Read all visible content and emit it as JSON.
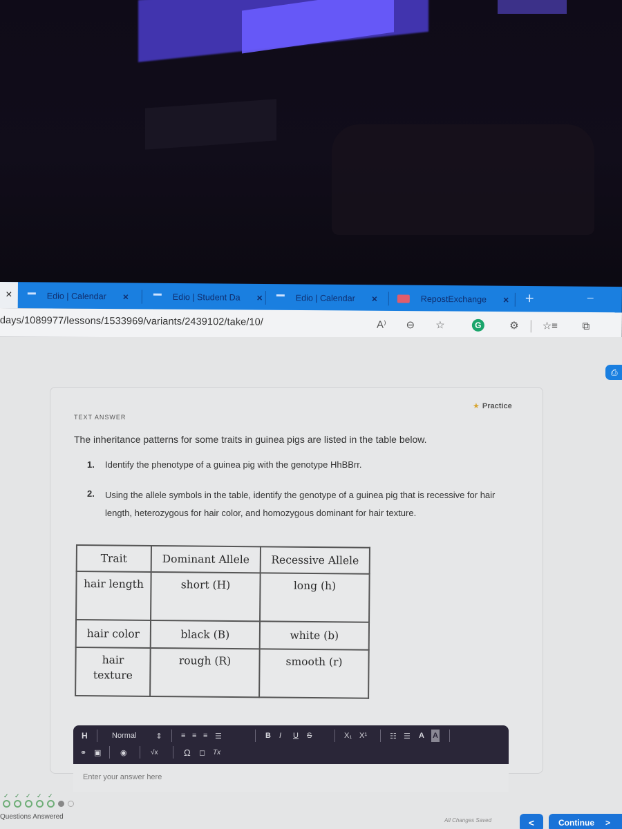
{
  "browser": {
    "tabs": [
      {
        "label": "Edio | Calendar",
        "favicon": "dash-icon"
      },
      {
        "label": "Edio | Student Da",
        "favicon": "dash-icon"
      },
      {
        "label": "Edio | Calendar",
        "favicon": "dash-icon"
      },
      {
        "label": "RepostExchange",
        "favicon": "repostexchange-icon"
      }
    ],
    "close_glyph": "×",
    "new_tab_glyph": "+",
    "minimize_glyph": "–",
    "url": "days/1089977/lessons/1533969/variants/2439102/take/10/",
    "toolbar_icons": [
      "read-aloud-icon",
      "zoom-out-icon",
      "add-favorite-icon",
      "grammarly-icon",
      "extensions-icon",
      "favorites-icon",
      "collections-icon"
    ],
    "toolbar_glyphs": {
      "read_aloud": "A⁾",
      "zoom_out": "⊖",
      "add_favorite": "☆",
      "grammarly": "G",
      "extensions": "⚙",
      "favorites": "☆≡",
      "collections": "⧉"
    }
  },
  "question": {
    "badge": "Practice",
    "badge_icon": "★",
    "type_label": "TEXT ANSWER",
    "intro": "The inheritance patterns for some traits in guinea pigs are listed in the table below.",
    "items": [
      {
        "num": "1.",
        "text": "Identify the phenotype of a guinea pig with the genotype HhBBrr."
      },
      {
        "num": "2.",
        "text": "Using the allele symbols in the table, identify the genotype of a guinea pig that is recessive for hair length, heterozygous for hair color, and homozygous dominant for hair texture."
      }
    ],
    "table": {
      "headers": [
        "Trait",
        "Dominant Allele",
        "Recessive Allele"
      ],
      "rows": [
        [
          "hair length",
          "short (H)",
          "long (h)"
        ],
        [
          "hair color",
          "black (B)",
          "white (b)"
        ],
        [
          "hair texture",
          "rough (R)",
          "smooth (r)"
        ]
      ]
    }
  },
  "editor": {
    "heading_btn": "H",
    "style_select": "Normal",
    "style_caret": "⇕",
    "row1_icons": [
      "align-left-icon",
      "align-center-icon",
      "align-right-icon",
      "align-justify-icon",
      "bold-icon",
      "italic-icon",
      "underline-icon",
      "strikethrough-icon",
      "subscript-icon",
      "superscript-icon",
      "ordered-list-icon",
      "bullet-list-icon",
      "font-color-icon",
      "highlight-icon"
    ],
    "row1_glyphs": {
      "bold": "B",
      "italic": "I",
      "underline": "U",
      "strike": "S",
      "sub": "X₁",
      "sup": "X¹",
      "font_color": "A",
      "highlight": "A"
    },
    "row2_icons": [
      "link-icon",
      "image-icon",
      "media-icon",
      "math-icon",
      "special-char-icon",
      "table-icon",
      "clear-format-icon"
    ],
    "row2_glyphs": {
      "link": "⚭",
      "image": "▣",
      "media": "◉",
      "math": "√x",
      "omega": "Ω",
      "table": "◻",
      "clear": "Tx"
    },
    "placeholder": "Enter your answer here"
  },
  "footer": {
    "progress": {
      "answered": 5,
      "current": 6,
      "total": 7
    },
    "progress_label": "Questions Answered",
    "saved_status": "All Changes Saved",
    "back_glyph": "<",
    "continue_label": "Continue",
    "continue_glyph": ">"
  },
  "colors": {
    "tab_strip": "#1a7fe0",
    "primary_button": "#1a73d8",
    "editor_toolbar": "#2a2638",
    "progress_done": "#6fae78",
    "practice_star": "#d7a532"
  }
}
